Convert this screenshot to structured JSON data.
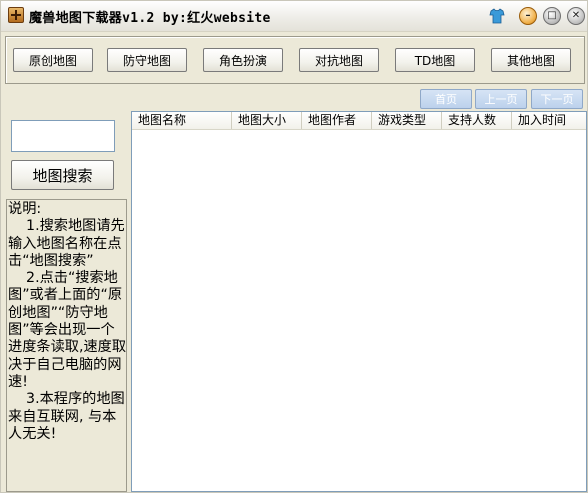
{
  "window": {
    "title": "魔兽地图下载器v1.2  by:红火website"
  },
  "colors": {
    "face": "#ECE9D8",
    "disabled_button": "#BCD1EC",
    "list_border": "#7F9DB9"
  },
  "toolbar": {
    "map_buttons": [
      "原创地图",
      "防守地图",
      "角色扮演",
      "对抗地图",
      "TD地图",
      "其他地图"
    ]
  },
  "pager": {
    "first": "首页",
    "prev": "上一页",
    "next": "下一页"
  },
  "search": {
    "value": "",
    "button_label": "地图搜索"
  },
  "description": {
    "heading": "说明:",
    "item1": "    1.搜索地图请先输入地图名称在点击“地图搜索”",
    "item2": "    2.点击“搜索地图”或者上面的“原创地图”“防守地图”等会出现一个进度条读取,速度取决于自己电脑的网速!",
    "item3": "    3.本程序的地图来自互联网, 与本人无关!"
  },
  "table": {
    "columns": [
      "地图名称",
      "地图大小",
      "地图作者",
      "游戏类型",
      "支持人数",
      "加入时间"
    ],
    "rows": []
  }
}
